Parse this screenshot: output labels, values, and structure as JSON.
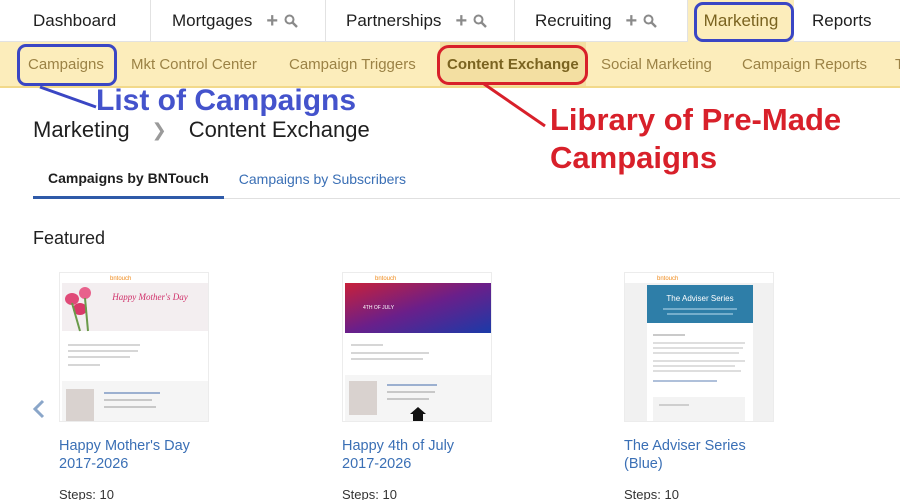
{
  "topnav": {
    "tabs": [
      {
        "label": "Dashboard"
      },
      {
        "label": "Mortgages"
      },
      {
        "label": "Partnerships"
      },
      {
        "label": "Recruiting"
      },
      {
        "label": "Marketing"
      },
      {
        "label": "Reports"
      }
    ]
  },
  "subnav": {
    "items": [
      {
        "label": "Campaigns"
      },
      {
        "label": "Mkt Control Center"
      },
      {
        "label": "Campaign Triggers"
      },
      {
        "label": "Content Exchange"
      },
      {
        "label": "Social Marketing"
      },
      {
        "label": "Campaign Reports"
      }
    ]
  },
  "annotations": {
    "campaigns_note": "List of Campaigns",
    "exchange_note_line1": "Library of Pre-Made",
    "exchange_note_line2": "Campaigns"
  },
  "breadcrumb": {
    "root": "Marketing",
    "current": "Content Exchange"
  },
  "content_tabs": [
    {
      "label": "Campaigns by BNTouch"
    },
    {
      "label": "Campaigns by Subscribers"
    }
  ],
  "featured": {
    "title": "Featured",
    "cards": [
      {
        "title_line1": "Happy Mother's Day",
        "title_line2": "2017-2026",
        "steps": "Steps: 10",
        "thumb_brand": "bntouch",
        "thumb_heading": "Happy Mother's Day"
      },
      {
        "title_line1": "Happy 4th of July",
        "title_line2": "2017-2026",
        "steps": "Steps: 10",
        "thumb_brand": "bntouch",
        "thumb_heading": "4TH OF JULY"
      },
      {
        "title_line1": "The Adviser Series",
        "title_line2": "(Blue)",
        "steps": "Steps: 10",
        "thumb_brand": "bntouch",
        "thumb_heading": "The Adviser Series"
      }
    ]
  },
  "colors": {
    "nav_highlight": "#fcedbb",
    "annotation_blue": "#3a46c4",
    "annotation_red": "#d8202a",
    "link_blue": "#3a6fb5"
  }
}
